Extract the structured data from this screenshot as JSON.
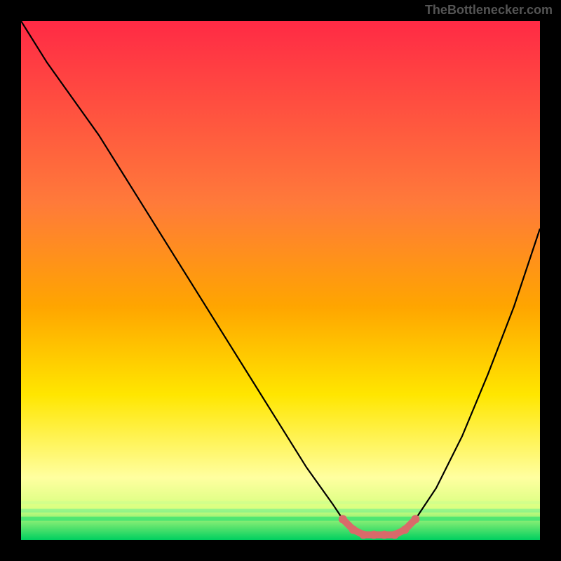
{
  "watermark": "TheBottlenecker.com",
  "chart_data": {
    "type": "line",
    "title": "",
    "xlabel": "",
    "ylabel": "",
    "xlim": [
      0,
      100
    ],
    "ylim": [
      0,
      100
    ],
    "series": [
      {
        "name": "curve",
        "x": [
          0,
          5,
          10,
          15,
          20,
          25,
          30,
          35,
          40,
          45,
          50,
          55,
          60,
          62,
          64,
          67,
          70,
          72,
          74,
          76,
          80,
          85,
          90,
          95,
          100
        ],
        "values": [
          100,
          92,
          85,
          78,
          70,
          62,
          54,
          46,
          38,
          30,
          22,
          14,
          7,
          4,
          2,
          1,
          1,
          1,
          2,
          4,
          10,
          20,
          32,
          45,
          60
        ]
      }
    ],
    "markers": {
      "color": "#D96A6A",
      "points": [
        {
          "x": 62,
          "y": 4
        },
        {
          "x": 64,
          "y": 2
        },
        {
          "x": 66,
          "y": 1
        },
        {
          "x": 68,
          "y": 1
        },
        {
          "x": 70,
          "y": 1
        },
        {
          "x": 72,
          "y": 1
        },
        {
          "x": 74,
          "y": 2
        },
        {
          "x": 76,
          "y": 4
        }
      ]
    },
    "background_gradient": {
      "top": "#FF2A45",
      "mid1": "#FFA500",
      "mid2": "#FFE600",
      "bottom_yellow": "#FFFFA0",
      "green": "#00D060"
    }
  }
}
